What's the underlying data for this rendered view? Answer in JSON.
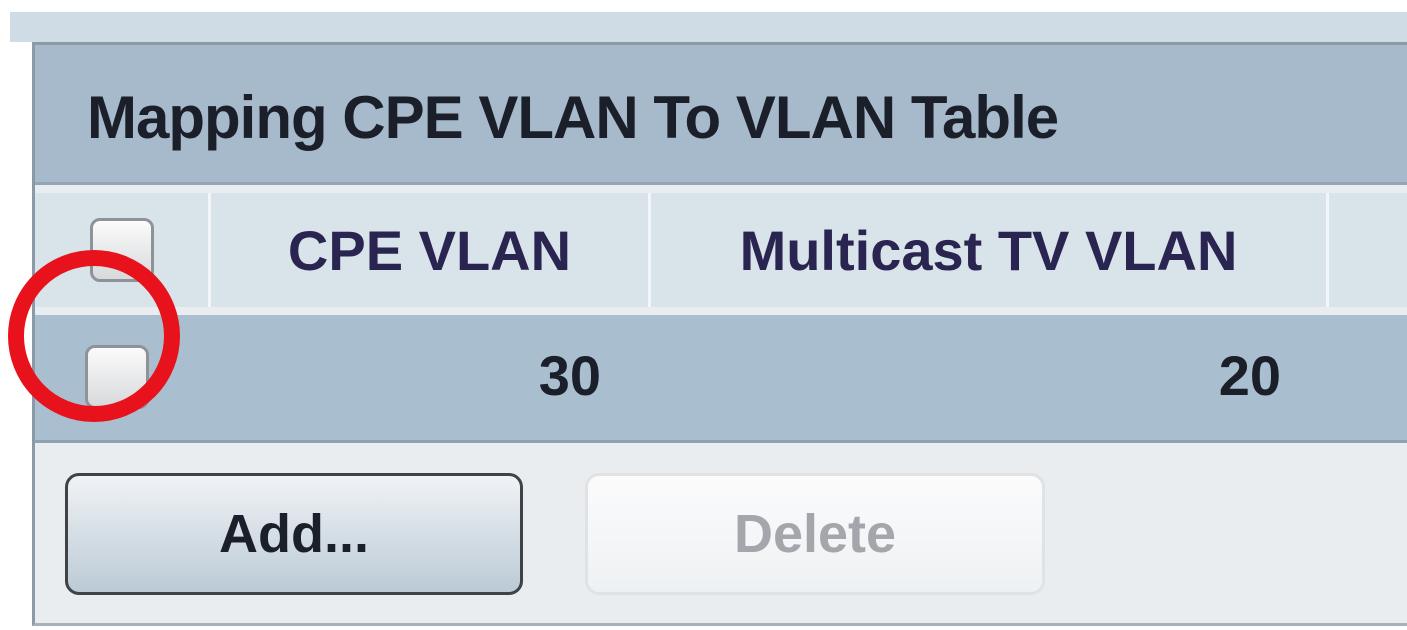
{
  "table": {
    "title": "Mapping CPE VLAN To VLAN Table",
    "columns": {
      "cpe_vlan": "CPE VLAN",
      "multicast_tv_vlan": "Multicast TV VLAN"
    },
    "rows": [
      {
        "cpe_vlan": "30",
        "multicast_tv_vlan": "20",
        "selected": false,
        "highlighted": true
      }
    ]
  },
  "buttons": {
    "add_label": "Add...",
    "delete_label": "Delete",
    "delete_enabled": false
  },
  "colors": {
    "title_bar": "#a7bacb",
    "header_row": "#d9e3ea",
    "data_row": "#a9bfd0",
    "highlight_ring": "#e8121c"
  }
}
